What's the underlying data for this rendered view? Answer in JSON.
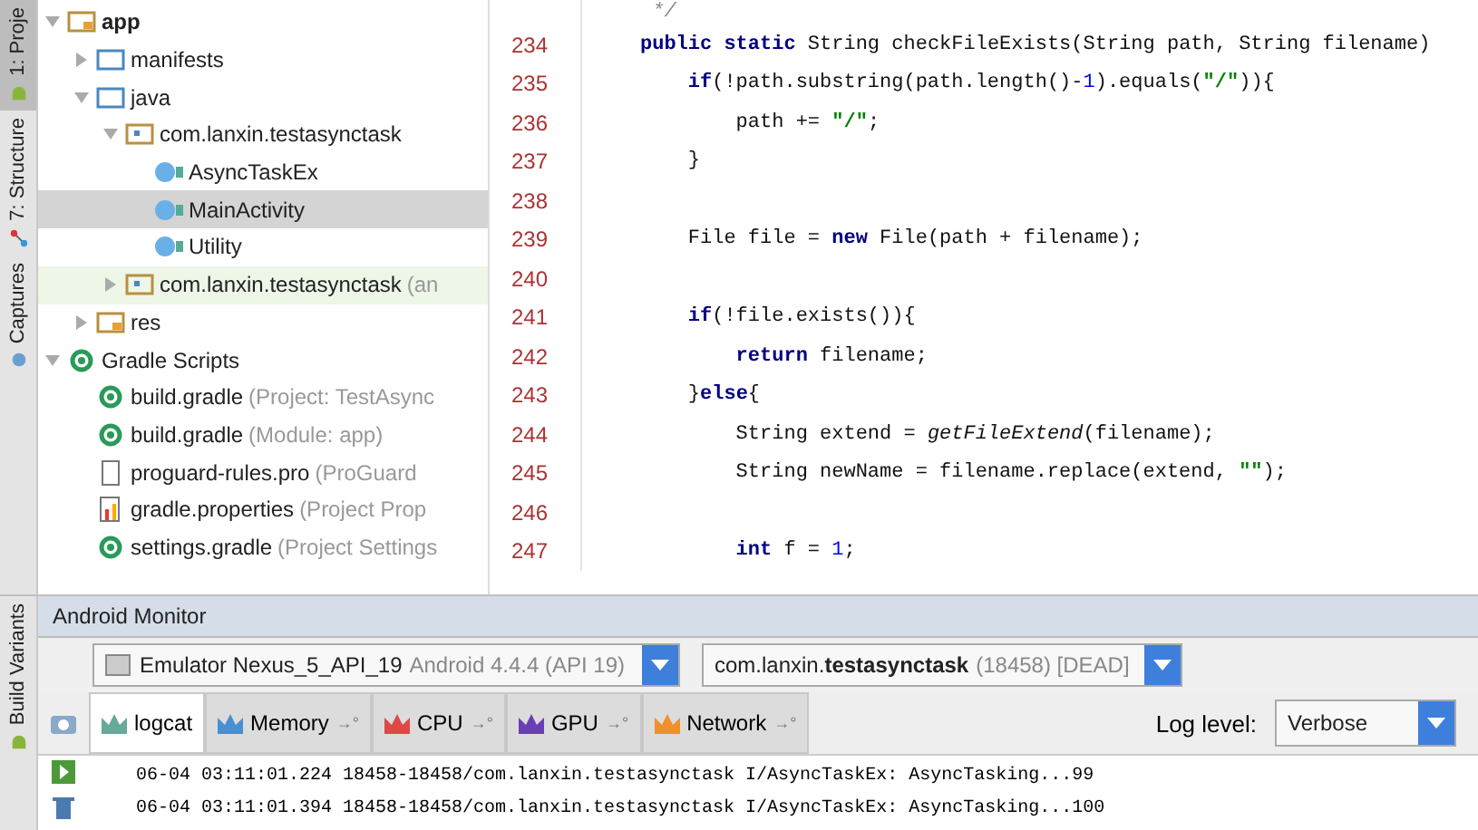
{
  "side_tabs": [
    {
      "label": "1: Proje",
      "selected": true
    },
    {
      "label": "7: Structure",
      "selected": false
    },
    {
      "label": "Captures",
      "selected": false
    }
  ],
  "bottom_side_tab": {
    "label": "Build Variants"
  },
  "project_tree": [
    {
      "label": "app",
      "kind": "module",
      "expanded": true,
      "selected": false,
      "children": [
        {
          "label": "manifests",
          "kind": "folder",
          "expanded": false,
          "selected": false
        },
        {
          "label": "java",
          "kind": "folder",
          "expanded": true,
          "selected": false,
          "children": [
            {
              "label": "com.lanxin.testasynctask",
              "kind": "package",
              "expanded": true,
              "selected": false,
              "children": [
                {
                  "label": "AsyncTaskEx",
                  "kind": "class",
                  "selected": false
                },
                {
                  "label": "MainActivity",
                  "kind": "class",
                  "selected": true
                },
                {
                  "label": "Utility",
                  "kind": "class",
                  "selected": false
                }
              ]
            },
            {
              "label": "com.lanxin.testasynctask",
              "hint": "(an",
              "kind": "test_package",
              "expanded": false,
              "selected": false
            }
          ]
        },
        {
          "label": "res",
          "kind": "res",
          "expanded": false,
          "selected": false
        }
      ]
    },
    {
      "label": "Gradle Scripts",
      "kind": "gradle",
      "expanded": true,
      "selected": false,
      "children": [
        {
          "label": "build.gradle",
          "hint": "(Project: TestAsync",
          "kind": "gradle",
          "selected": false
        },
        {
          "label": "build.gradle",
          "hint": "(Module: app)",
          "kind": "gradle",
          "selected": false
        },
        {
          "label": "proguard-rules.pro",
          "hint": "(ProGuard",
          "kind": "file",
          "selected": false
        },
        {
          "label": "gradle.properties",
          "hint": "(Project Prop",
          "kind": "props",
          "selected": false
        },
        {
          "label": "settings.gradle",
          "hint": "(Project Settings",
          "kind": "gradle",
          "selected": false
        }
      ]
    }
  ],
  "editor": {
    "lines": [
      {
        "tokens": [
          {
            "t": " */",
            "kind": "comment"
          }
        ]
      },
      {
        "number": "234",
        "tokens": [
          {
            "t": "public static",
            "kind": "kw"
          },
          {
            "t": " String checkFileExists(String path, String filename)",
            "kind": "plain"
          }
        ]
      },
      {
        "number": "235",
        "tokens": [
          {
            "t": "    if",
            "kind": "kw"
          },
          {
            "t": "(!path.substring(path.length()-",
            "kind": "plain"
          },
          {
            "t": "1",
            "kind": "num"
          },
          {
            "t": ").equals(",
            "kind": "plain"
          },
          {
            "t": "\"/\"",
            "kind": "str"
          },
          {
            "t": ")){",
            "kind": "plain"
          }
        ]
      },
      {
        "number": "236",
        "tokens": [
          {
            "t": "        path += ",
            "kind": "plain"
          },
          {
            "t": "\"/\"",
            "kind": "str"
          },
          {
            "t": ";",
            "kind": "plain"
          }
        ]
      },
      {
        "number": "237",
        "tokens": [
          {
            "t": "    }",
            "kind": "plain"
          }
        ]
      },
      {
        "number": "238"
      },
      {
        "number": "239",
        "tokens": [
          {
            "t": "    File file = ",
            "kind": "plain"
          },
          {
            "t": "new",
            "kind": "kw"
          },
          {
            "t": " File(path + filename);",
            "kind": "plain"
          }
        ]
      },
      {
        "number": "240"
      },
      {
        "number": "241",
        "tokens": [
          {
            "t": "    if",
            "kind": "kw"
          },
          {
            "t": "(!file.exists()){",
            "kind": "plain"
          }
        ]
      },
      {
        "number": "242",
        "tokens": [
          {
            "t": "        return",
            "kind": "kw"
          },
          {
            "t": " filename;",
            "kind": "plain"
          }
        ]
      },
      {
        "number": "243",
        "tokens": [
          {
            "t": "    }",
            "kind": "plain"
          },
          {
            "t": "else",
            "kind": "kw"
          },
          {
            "t": "{",
            "kind": "plain"
          }
        ]
      },
      {
        "number": "244",
        "tokens": [
          {
            "t": "        String extend = ",
            "kind": "plain"
          },
          {
            "t": "getFileExtend",
            "kind": "italic"
          },
          {
            "t": "(filename);",
            "kind": "plain"
          }
        ]
      },
      {
        "number": "245",
        "tokens": [
          {
            "t": "        String newName = filename.replace(extend, ",
            "kind": "plain"
          },
          {
            "t": "\"\"",
            "kind": "str"
          },
          {
            "t": ");",
            "kind": "plain"
          }
        ]
      },
      {
        "number": "246"
      },
      {
        "number": "247",
        "tokens": [
          {
            "t": "        int",
            "kind": "kw"
          },
          {
            "t": " f = ",
            "kind": "plain"
          },
          {
            "t": "1",
            "kind": "num"
          },
          {
            "t": ";",
            "kind": "plain"
          }
        ]
      }
    ]
  },
  "android_monitor": {
    "title": "Android Monitor",
    "device": {
      "name": "Emulator Nexus_5_API_19",
      "detail": "Android 4.4.4 (API 19)"
    },
    "process": {
      "prefix": "com.lanxin.",
      "name": "testasynctask",
      "detail": "(18458) [DEAD]"
    },
    "tabs": [
      {
        "label": "logcat",
        "selected": true
      },
      {
        "label": "Memory",
        "pin": "→°",
        "selected": false
      },
      {
        "label": "CPU",
        "pin": "→°",
        "selected": false
      },
      {
        "label": "GPU",
        "pin": "→°",
        "selected": false
      },
      {
        "label": "Network",
        "pin": "→°",
        "selected": false
      }
    ],
    "log_level": {
      "label": "Log level:",
      "value": "Verbose"
    },
    "log_lines": [
      "06-04 03:11:01.224 18458-18458/com.lanxin.testasynctask I/AsyncTaskEx: AsyncTasking...99",
      "06-04 03:11:01.394 18458-18458/com.lanxin.testasynctask I/AsyncTaskEx: AsyncTasking...100"
    ]
  }
}
